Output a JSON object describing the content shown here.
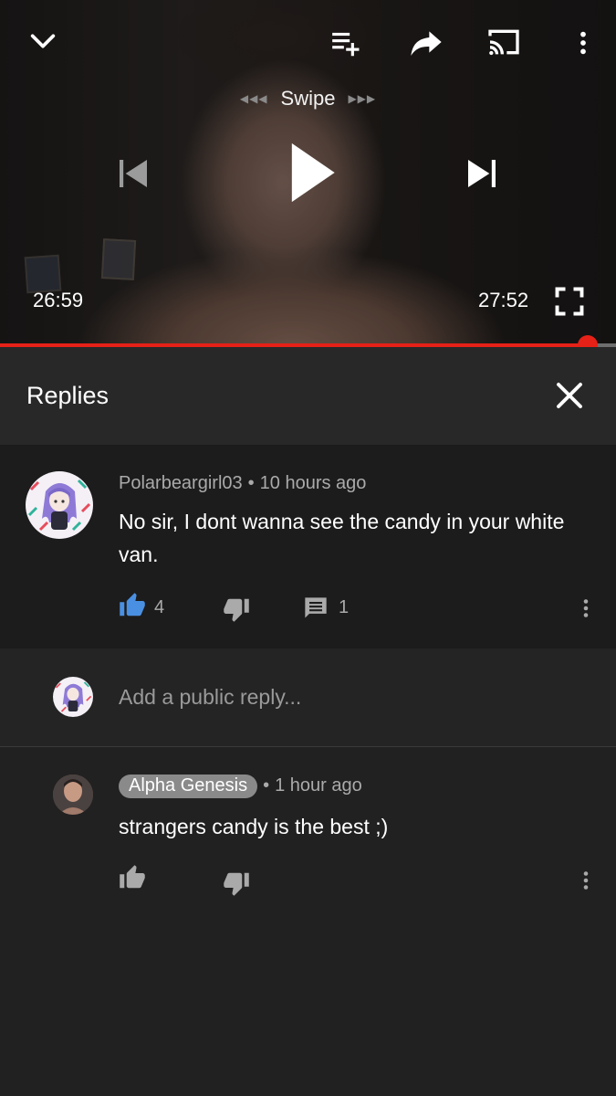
{
  "player": {
    "swipe_label": "Swipe",
    "swipe_left_arrows": "◀◀◀",
    "swipe_right_arrows": "▶▶▶",
    "current_time": "26:59",
    "duration": "27:52",
    "progress_fraction": 0.954,
    "accent_color": "#e62117"
  },
  "replies_panel": {
    "title": "Replies"
  },
  "parent_comment": {
    "author": "Polarbeargirl03",
    "separator": "•",
    "time_ago": "10 hours ago",
    "text": "No sir, I dont wanna see the candy in your white van.",
    "like_count": "4",
    "reply_count": "1",
    "like_active_color": "#4a90e2"
  },
  "add_reply": {
    "placeholder": "Add a public reply..."
  },
  "reply": {
    "author": "Alpha Genesis",
    "separator": "•",
    "time_ago": "1 hour ago",
    "text": "strangers candy is the best ;)"
  }
}
